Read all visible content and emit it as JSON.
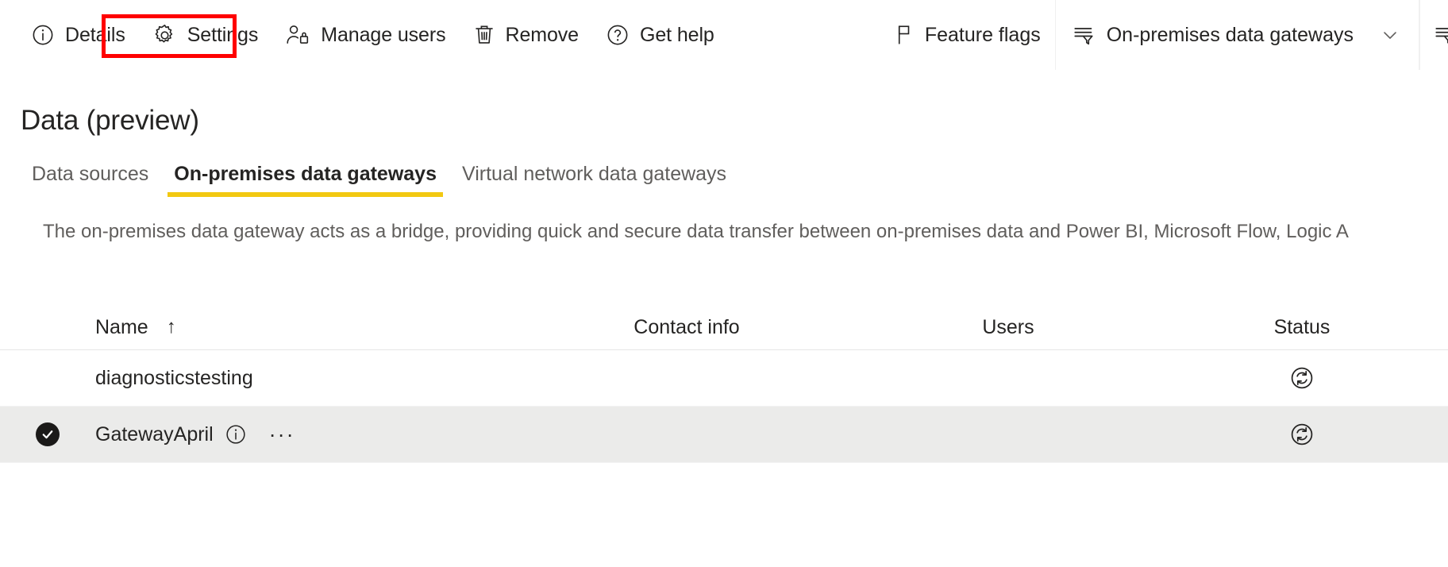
{
  "commandbar": {
    "items": [
      {
        "label": "Details",
        "icon": "info-icon",
        "name": "details"
      },
      {
        "label": "Settings",
        "icon": "gear-icon",
        "name": "settings"
      },
      {
        "label": "Manage users",
        "icon": "manage-users-icon",
        "name": "manage-users"
      },
      {
        "label": "Remove",
        "icon": "trash-icon",
        "name": "remove"
      },
      {
        "label": "Get help",
        "icon": "question-circle-icon",
        "name": "get-help"
      }
    ],
    "feature_flags": {
      "label": "Feature flags",
      "icon": "flag-icon"
    },
    "filter": {
      "label": "On-premises data gateways",
      "icon": "filter-icon",
      "chevron": "chevron-down-icon"
    },
    "secondary_filter": {
      "icon": "filter-icon"
    },
    "highlight_color": "#ff0000",
    "highlighted_item": "Settings"
  },
  "page": {
    "title": "Data (preview)",
    "description": "The on-premises data gateway acts as a bridge, providing quick and secure data transfer between on-premises data and Power BI, Microsoft Flow, Logic A"
  },
  "tabs": [
    {
      "label": "Data sources",
      "active": false
    },
    {
      "label": "On-premises data gateways",
      "active": true
    },
    {
      "label": "Virtual network data gateways",
      "active": false
    }
  ],
  "accent_color": "#f2c811",
  "table": {
    "columns": [
      {
        "label": "Name",
        "sort": "↑"
      },
      {
        "label": "Contact info"
      },
      {
        "label": "Users"
      },
      {
        "label": "Status"
      }
    ],
    "rows": [
      {
        "selected": false,
        "name": "diagnosticstesting",
        "contact_info": "",
        "users": "",
        "status_icon": "refresh-circle-icon"
      },
      {
        "selected": true,
        "name": "GatewayApril",
        "info_icon": "info-icon",
        "overflow": "···",
        "contact_info": "",
        "users": "",
        "status_icon": "refresh-circle-icon"
      }
    ]
  }
}
